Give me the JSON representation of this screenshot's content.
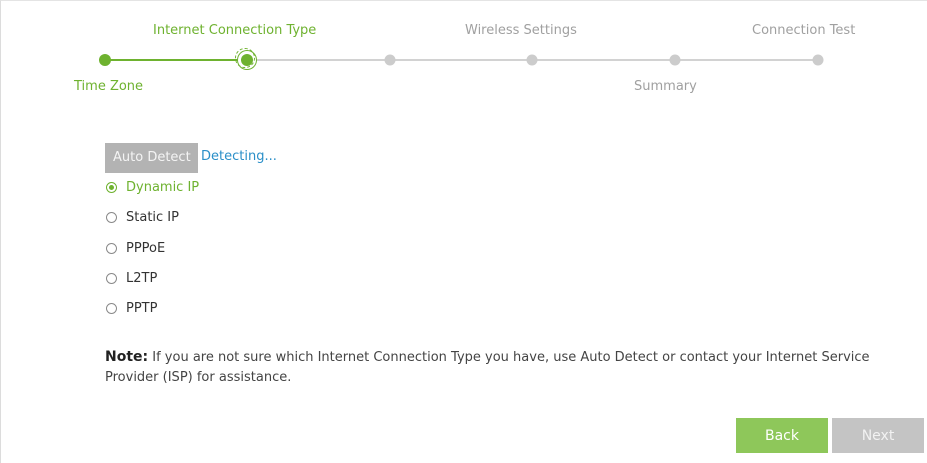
{
  "stepper": {
    "steps": [
      {
        "label": "Time Zone",
        "state": "done"
      },
      {
        "label": "Internet Connection Type",
        "state": "current"
      },
      {
        "label": "",
        "state": "pending"
      },
      {
        "label": "Wireless Settings",
        "state": "pending"
      },
      {
        "label": "Summary",
        "state": "pending"
      },
      {
        "label": "Connection Test",
        "state": "pending"
      }
    ],
    "active_color": "#6eb22f",
    "inactive_color": "#cccccc"
  },
  "detect": {
    "button_label": "Auto Detect",
    "status_text": "Detecting..."
  },
  "connection_types": {
    "selected": "Dynamic IP",
    "options": [
      "Dynamic IP",
      "Static IP",
      "PPPoE",
      "L2TP",
      "PPTP"
    ]
  },
  "note": {
    "label": "Note:",
    "text": " If you are not sure which Internet Connection Type you have, use Auto Detect or contact your Internet Service Provider (ISP) for assistance."
  },
  "footer": {
    "back_label": "Back",
    "next_label": "Next"
  },
  "colors": {
    "accent": "#6eb22f",
    "link": "#2a8fc8",
    "button_back": "#8ec75a",
    "button_disabled": "#c4c4c4"
  }
}
